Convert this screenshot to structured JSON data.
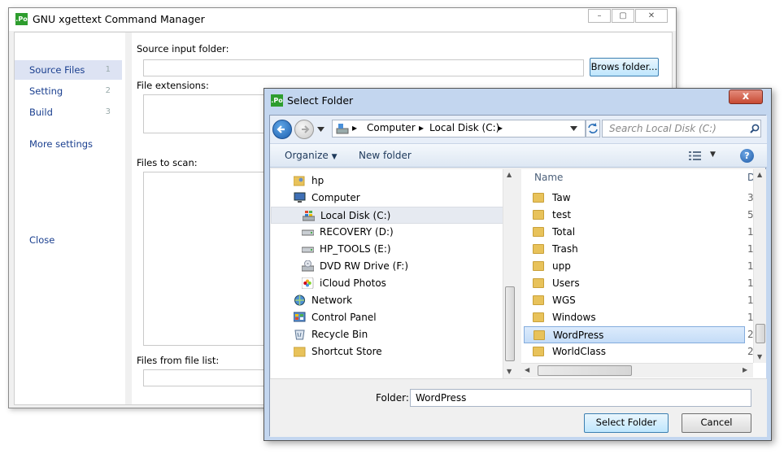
{
  "main_window": {
    "app_icon": ".Po",
    "title": "GNU xgettext Command Manager",
    "controls": {
      "minimize": "–",
      "maximize": "▢",
      "close": "✕"
    },
    "nav": [
      {
        "label": "Source Files",
        "num": "1",
        "active": true
      },
      {
        "label": "Setting",
        "num": "2"
      },
      {
        "label": "Build",
        "num": "3"
      },
      {
        "label": "More settings"
      },
      {
        "label": "Close"
      }
    ],
    "form": {
      "source_label": "Source input folder:",
      "source_value": "",
      "browse_button": "Brows folder...",
      "extensions_label": "File extensions:",
      "files_label": "Files to scan:",
      "from_list_label": "Files from file list:"
    }
  },
  "dialog": {
    "app_icon": ".Po",
    "title": "Select Folder",
    "close": "x",
    "breadcrumb": [
      "Computer",
      "Local Disk (C:)"
    ],
    "search_placeholder": "Search Local Disk (C:)",
    "toolbar": {
      "organize": "Organize",
      "new_folder": "New folder",
      "help": "?"
    },
    "tree": [
      {
        "label": "hp",
        "icon": "user-folder-icon",
        "level": 1
      },
      {
        "label": "Computer",
        "icon": "computer-icon",
        "level": 1
      },
      {
        "label": "Local Disk (C:)",
        "icon": "windows-drive-icon",
        "level": 2,
        "selected": true
      },
      {
        "label": "RECOVERY (D:)",
        "icon": "drive-icon",
        "level": 2
      },
      {
        "label": "HP_TOOLS (E:)",
        "icon": "drive-icon",
        "level": 2
      },
      {
        "label": "DVD RW Drive (F:)",
        "icon": "dvd-drive-icon",
        "level": 2
      },
      {
        "label": "iCloud Photos",
        "icon": "icloud-photos-icon",
        "level": 2
      },
      {
        "label": "Network",
        "icon": "network-icon",
        "level": 1
      },
      {
        "label": "Control Panel",
        "icon": "control-panel-icon",
        "level": 1
      },
      {
        "label": "Recycle Bin",
        "icon": "recycle-bin-icon",
        "level": 1
      },
      {
        "label": "Shortcut Store",
        "icon": "folder-icon",
        "level": 1
      }
    ],
    "list_header": {
      "name": "Name",
      "date": "D"
    },
    "files": [
      {
        "name": "Taw",
        "date": "3"
      },
      {
        "name": "test",
        "date": "5"
      },
      {
        "name": "Total",
        "date": "1"
      },
      {
        "name": "Trash",
        "date": "1"
      },
      {
        "name": "upp",
        "date": "1"
      },
      {
        "name": "Users",
        "date": "1"
      },
      {
        "name": "WGS",
        "date": "1"
      },
      {
        "name": "Windows",
        "date": "1"
      },
      {
        "name": "WordPress",
        "date": "2",
        "selected": true
      },
      {
        "name": "WorldClass",
        "date": "2"
      }
    ],
    "folder_label": "Folder:",
    "folder_value": "WordPress",
    "select_button": "Select Folder",
    "cancel_button": "Cancel",
    "colors": {
      "accent": "#1a3f8f",
      "selection": "#c4dcf7",
      "titlebar": "#c3d6ef",
      "close": "#c74a33"
    }
  }
}
